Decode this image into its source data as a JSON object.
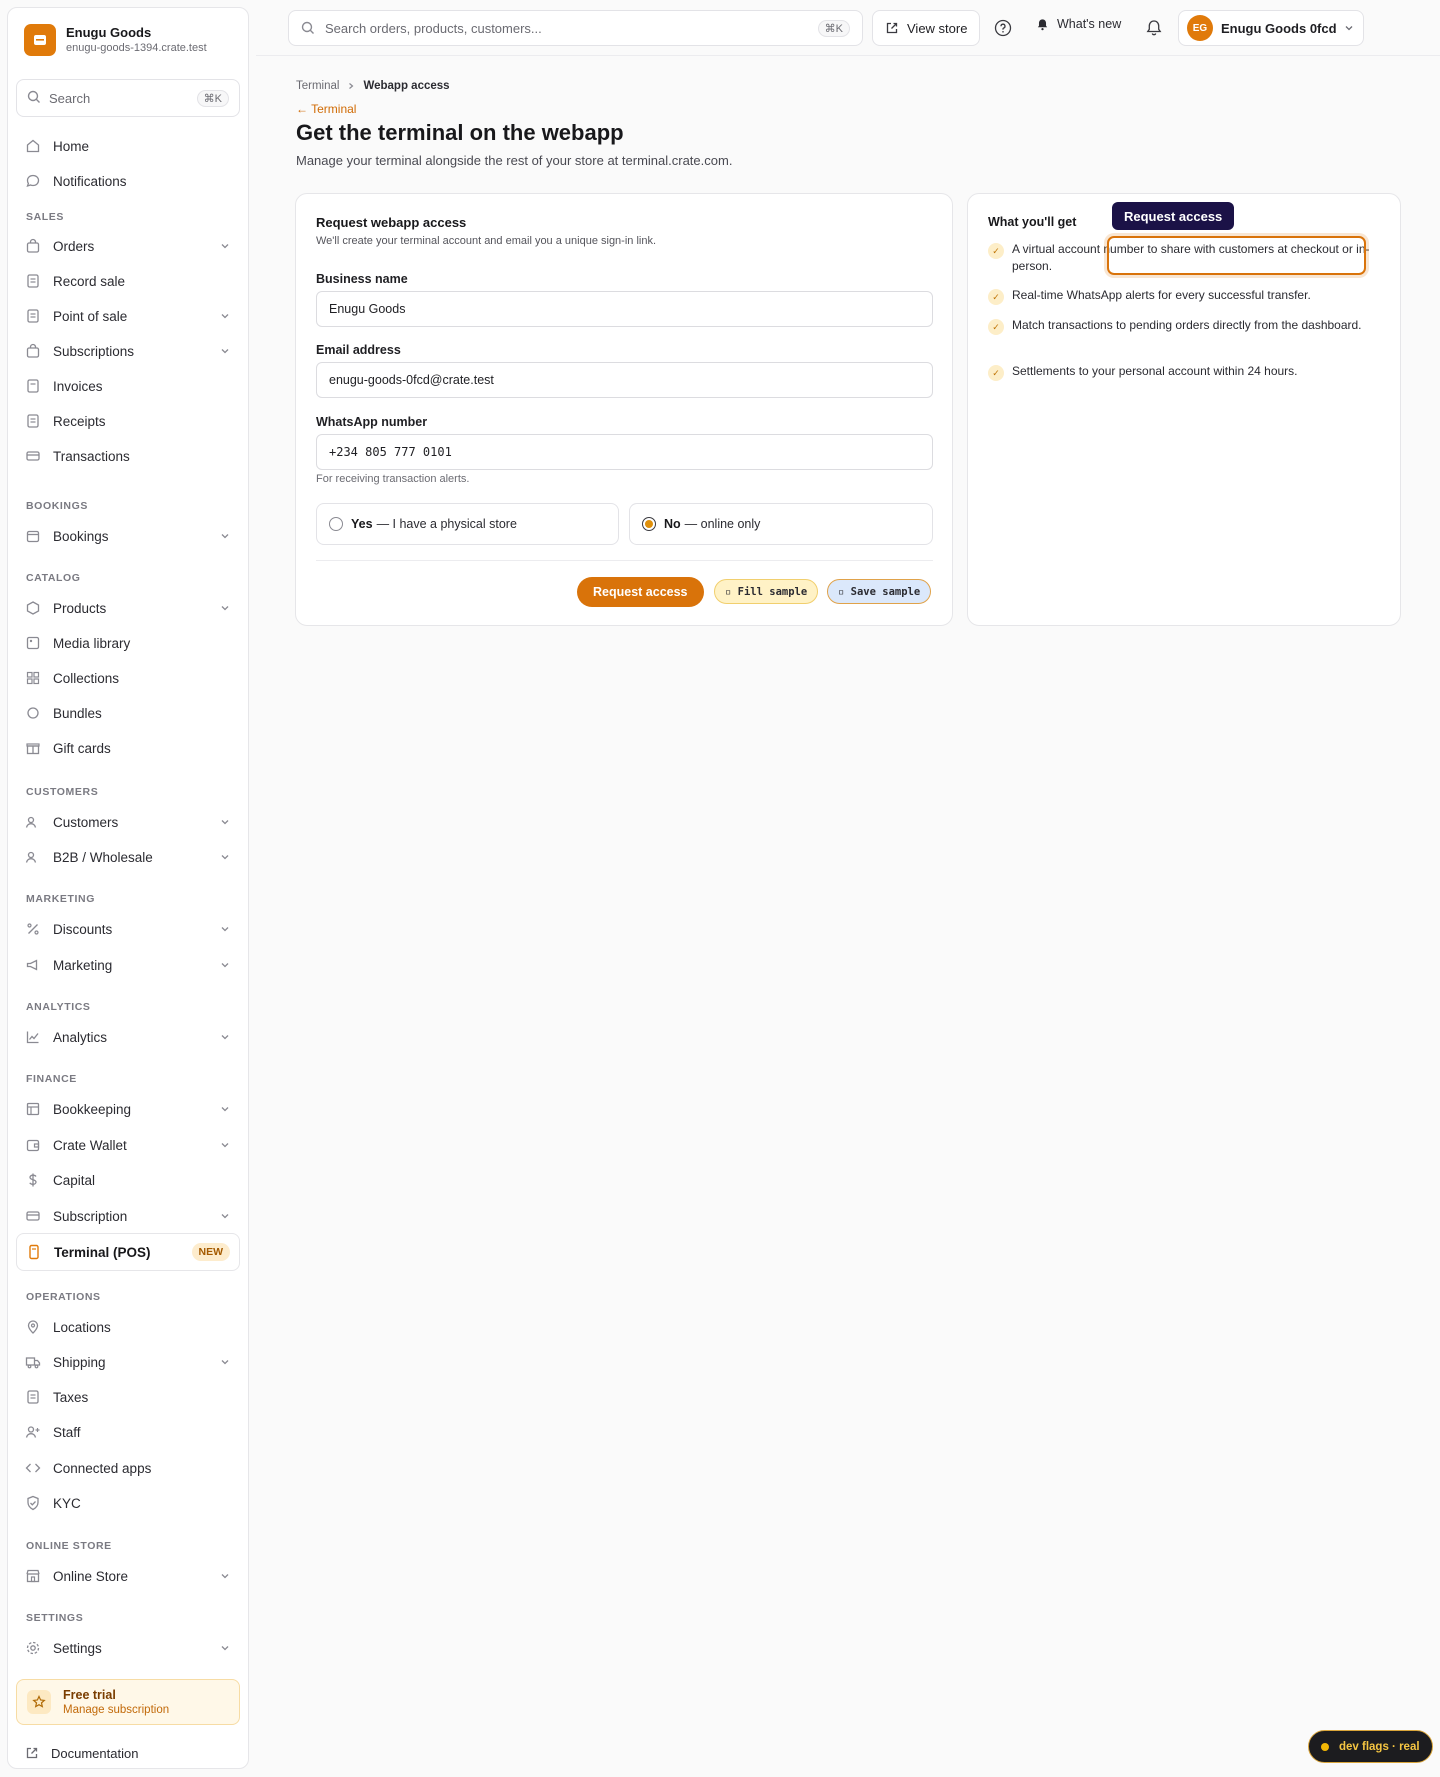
{
  "store": {
    "name": "Enugu Goods",
    "domain": "enugu-goods-1394.crate.test"
  },
  "sidebar_search": {
    "placeholder": "Search",
    "shortcut": "⌘K"
  },
  "nav": {
    "home": "Home",
    "notifications": "Notifications",
    "sections": {
      "sales": "SALES",
      "bookings": "BOOKINGS",
      "catalog": "CATALOG",
      "customers": "CUSTOMERS",
      "marketing": "MARKETING",
      "analytics": "ANALYTICS",
      "finance": "FINANCE",
      "operations": "OPERATIONS",
      "online_store": "ONLINE STORE",
      "settings": "SETTINGS"
    },
    "orders": "Orders",
    "record_sale": "Record sale",
    "point_of_sale": "Point of sale",
    "subscriptions": "Subscriptions",
    "invoices": "Invoices",
    "receipts": "Receipts",
    "transactions": "Transactions",
    "bookings": "Bookings",
    "products": "Products",
    "media_library": "Media library",
    "collections": "Collections",
    "bundles": "Bundles",
    "gift_cards": "Gift cards",
    "customers": "Customers",
    "b2b": "B2B / Wholesale",
    "discounts": "Discounts",
    "marketing": "Marketing",
    "analytics": "Analytics",
    "bookkeeping": "Bookkeeping",
    "crate_wallet": "Crate Wallet",
    "capital": "Capital",
    "subscription": "Subscription",
    "terminal": "Terminal (POS)",
    "terminal_badge": "NEW",
    "locations": "Locations",
    "shipping": "Shipping",
    "taxes": "Taxes",
    "staff": "Staff",
    "connected_apps": "Connected apps",
    "kyc": "KYC",
    "online_store": "Online Store",
    "settings": "Settings"
  },
  "trial": {
    "title": "Free trial",
    "link": "Manage subscription"
  },
  "documentation": "Documentation",
  "topbar": {
    "search_placeholder": "Search orders, products, customers...",
    "search_shortcut": "⌘K",
    "view_store": "View store",
    "whats_new": "What's new",
    "account_initials": "EG",
    "account_name": "Enugu Goods 0fcd"
  },
  "breadcrumb": {
    "parent": "Terminal",
    "current": "Webapp access"
  },
  "back_link": "← Terminal",
  "page": {
    "title": "Get the terminal on the webapp",
    "subtitle": "Manage your terminal alongside the rest of your store at terminal.crate.com."
  },
  "form": {
    "title": "Request webapp access",
    "subtitle": "We'll create your terminal account and email you a unique sign-in link.",
    "business_label": "Business name",
    "business_value": "Enugu Goods",
    "email_label": "Email address",
    "email_value": "enugu-goods-0fcd@crate.test",
    "whatsapp_label": "WhatsApp number",
    "whatsapp_value": "+234 805 777 0101",
    "whatsapp_hint": "For receiving transaction alerts.",
    "radio_yes_bold": "Yes",
    "radio_yes_text": "— I have a physical store",
    "radio_no_bold": "No",
    "radio_no_text": "— online only",
    "selected": "No",
    "submit": "Request access",
    "fill_sample": "▫ Fill sample",
    "save_sample": "▫ Save sample"
  },
  "benefits": {
    "title": "What you'll get",
    "items": [
      "A virtual account number to share with customers at checkout or in-person.",
      "Real-time WhatsApp alerts for every successful transfer.",
      "Match transactions to pending orders directly from the dashboard.",
      "Settlements to your personal account within 24 hours."
    ]
  },
  "tooltip": "Request access",
  "dev_flags": "dev flags · real",
  "colors": {
    "accent": "#d9730a",
    "tooltip_bg": "#1b1247"
  }
}
